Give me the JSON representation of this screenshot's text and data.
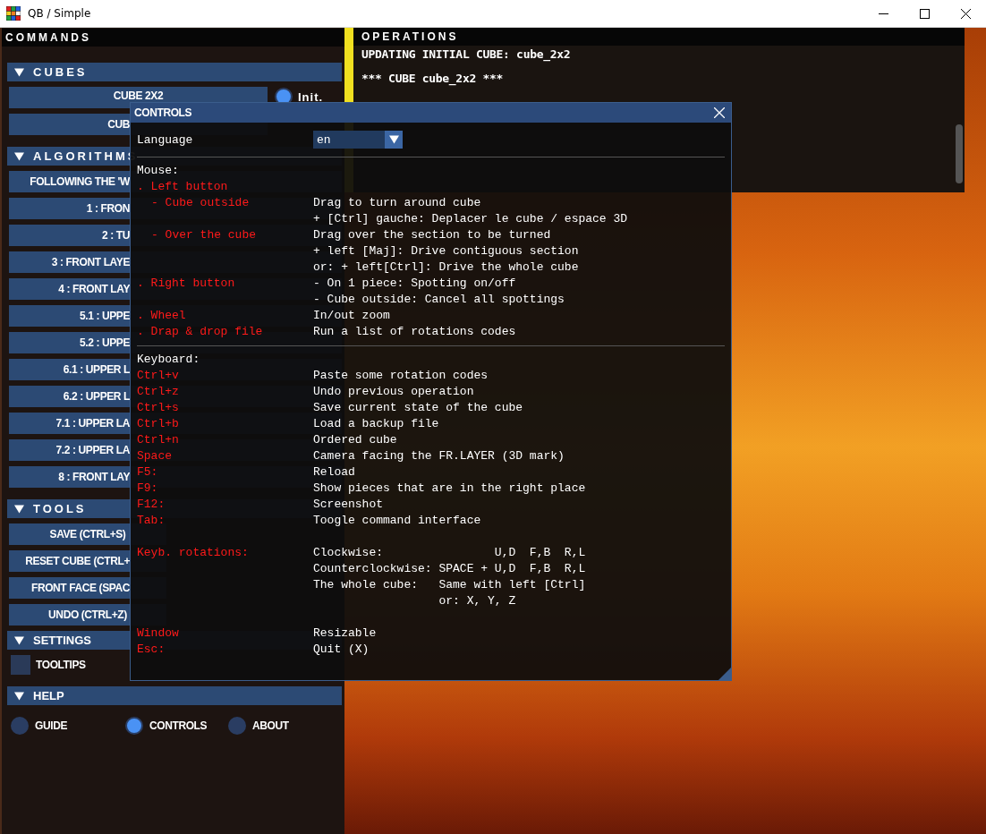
{
  "window": {
    "title": "QB / Simple"
  },
  "commands": {
    "title": "COMMANDS",
    "sections": [
      {
        "kind": "cubes",
        "title": "CUBES",
        "items": [
          {
            "label": "CUBE 2X2",
            "covered": false,
            "radio": {
              "label": "Init.",
              "selected": true
            }
          },
          {
            "label": "CUB",
            "covered": true
          }
        ]
      },
      {
        "kind": "list",
        "title": "ALGORITHMS",
        "items": [
          {
            "label": "FOLLOWING THE 'W",
            "covered": true
          },
          {
            "label": "1 : FRON",
            "covered": true
          },
          {
            "label": "2 : TU",
            "covered": true
          },
          {
            "label": "3 : FRONT LAYE",
            "covered": true
          },
          {
            "label": "4 : FRONT LAY",
            "covered": true
          },
          {
            "label": "5.1 : UPPE",
            "covered": true
          },
          {
            "label": "5.2 : UPPE",
            "covered": true
          },
          {
            "label": "6.1 : UPPER L",
            "covered": true
          },
          {
            "label": "6.2 : UPPER L",
            "covered": true
          },
          {
            "label": "7.1 : UPPER LA",
            "covered": true
          },
          {
            "label": "7.2 : UPPER LA",
            "covered": true
          },
          {
            "label": "8 : FRONT LAY",
            "covered": true
          }
        ]
      },
      {
        "kind": "tools",
        "title": "TOOLS",
        "items": [
          {
            "label": "SAVE (CTRL+S)",
            "covered": false
          },
          {
            "label": "RESET CUBE (CTRL+",
            "covered": true
          },
          {
            "label": "FRONT FACE (SPAC",
            "covered": true
          },
          {
            "label": "UNDO (CTRL+Z)",
            "covered": false
          }
        ]
      },
      {
        "kind": "settings",
        "title": "SETTINGS",
        "items": [
          {
            "label": "TOOLTIPS",
            "checked": false
          }
        ]
      },
      {
        "kind": "help",
        "title": "HELP",
        "items": [
          {
            "label": "GUIDE",
            "selected": false
          },
          {
            "label": "CONTROLS",
            "selected": true
          },
          {
            "label": "ABOUT",
            "selected": false
          }
        ]
      }
    ]
  },
  "operations": {
    "title": "OPERATIONS",
    "lines": [
      "UPDATING INITIAL CUBE: cube_2x2",
      "*** CUBE cube_2x2 ***"
    ]
  },
  "dialog": {
    "title": "CONTROLS",
    "language": {
      "label": "Language",
      "value": "en"
    },
    "mouse": {
      "title": "Mouse:",
      "rows": [
        {
          "label": ". Left button",
          "children": [
            {
              "label": "- Cube outside",
              "lines": [
                "Drag to turn around cube",
                "+ [Ctrl] gauche: Deplacer le cube / espace 3D"
              ]
            },
            {
              "label": "- Over the cube",
              "lines": [
                "Drag over the section to be turned",
                "+ left [Maj]: Drive contiguous section",
                "or: + left[Ctrl]: Drive the whole cube"
              ]
            }
          ]
        },
        {
          "label": ". Right button",
          "lines": [
            "- On 1 piece: Spotting on/off",
            "- Cube outside: Cancel all spottings"
          ]
        },
        {
          "label": ". Wheel",
          "lines": [
            "In/out zoom"
          ]
        },
        {
          "label": ". Drap & drop file",
          "lines": [
            "Run a list of rotations codes"
          ]
        }
      ]
    },
    "keyboard": {
      "title": "Keyboard:",
      "groups": [
        [
          {
            "label": "Ctrl+v",
            "lines": [
              "Paste some rotation codes"
            ]
          },
          {
            "label": "Ctrl+z",
            "lines": [
              "Undo previous operation"
            ]
          },
          {
            "label": "Ctrl+s",
            "lines": [
              "Save current state of the cube"
            ]
          },
          {
            "label": "Ctrl+b",
            "lines": [
              "Load a backup file"
            ]
          },
          {
            "label": "Ctrl+n",
            "lines": [
              "Ordered cube"
            ]
          },
          {
            "label": "Space",
            "lines": [
              "Camera facing the FR.LAYER (3D mark)"
            ]
          },
          {
            "label": "F5:",
            "lines": [
              "Reload"
            ]
          },
          {
            "label": "F9:",
            "lines": [
              "Show pieces that are in the right place"
            ]
          },
          {
            "label": "F12:",
            "lines": [
              "Screenshot"
            ]
          },
          {
            "label": "Tab:",
            "lines": [
              "Toogle command interface"
            ]
          }
        ],
        [
          {
            "label": "Keyb. rotations:",
            "lines": [
              "Clockwise:                U,D  F,B  R,L",
              "Counterclockwise: SPACE + U,D  F,B  R,L",
              "The whole cube:   Same with left [Ctrl]",
              "                  or: X, Y, Z"
            ]
          }
        ],
        [
          {
            "label": "Window",
            "lines": [
              "Resizable"
            ]
          },
          {
            "label": "Esc:",
            "lines": [
              "Quit (X)"
            ]
          }
        ]
      ]
    }
  }
}
